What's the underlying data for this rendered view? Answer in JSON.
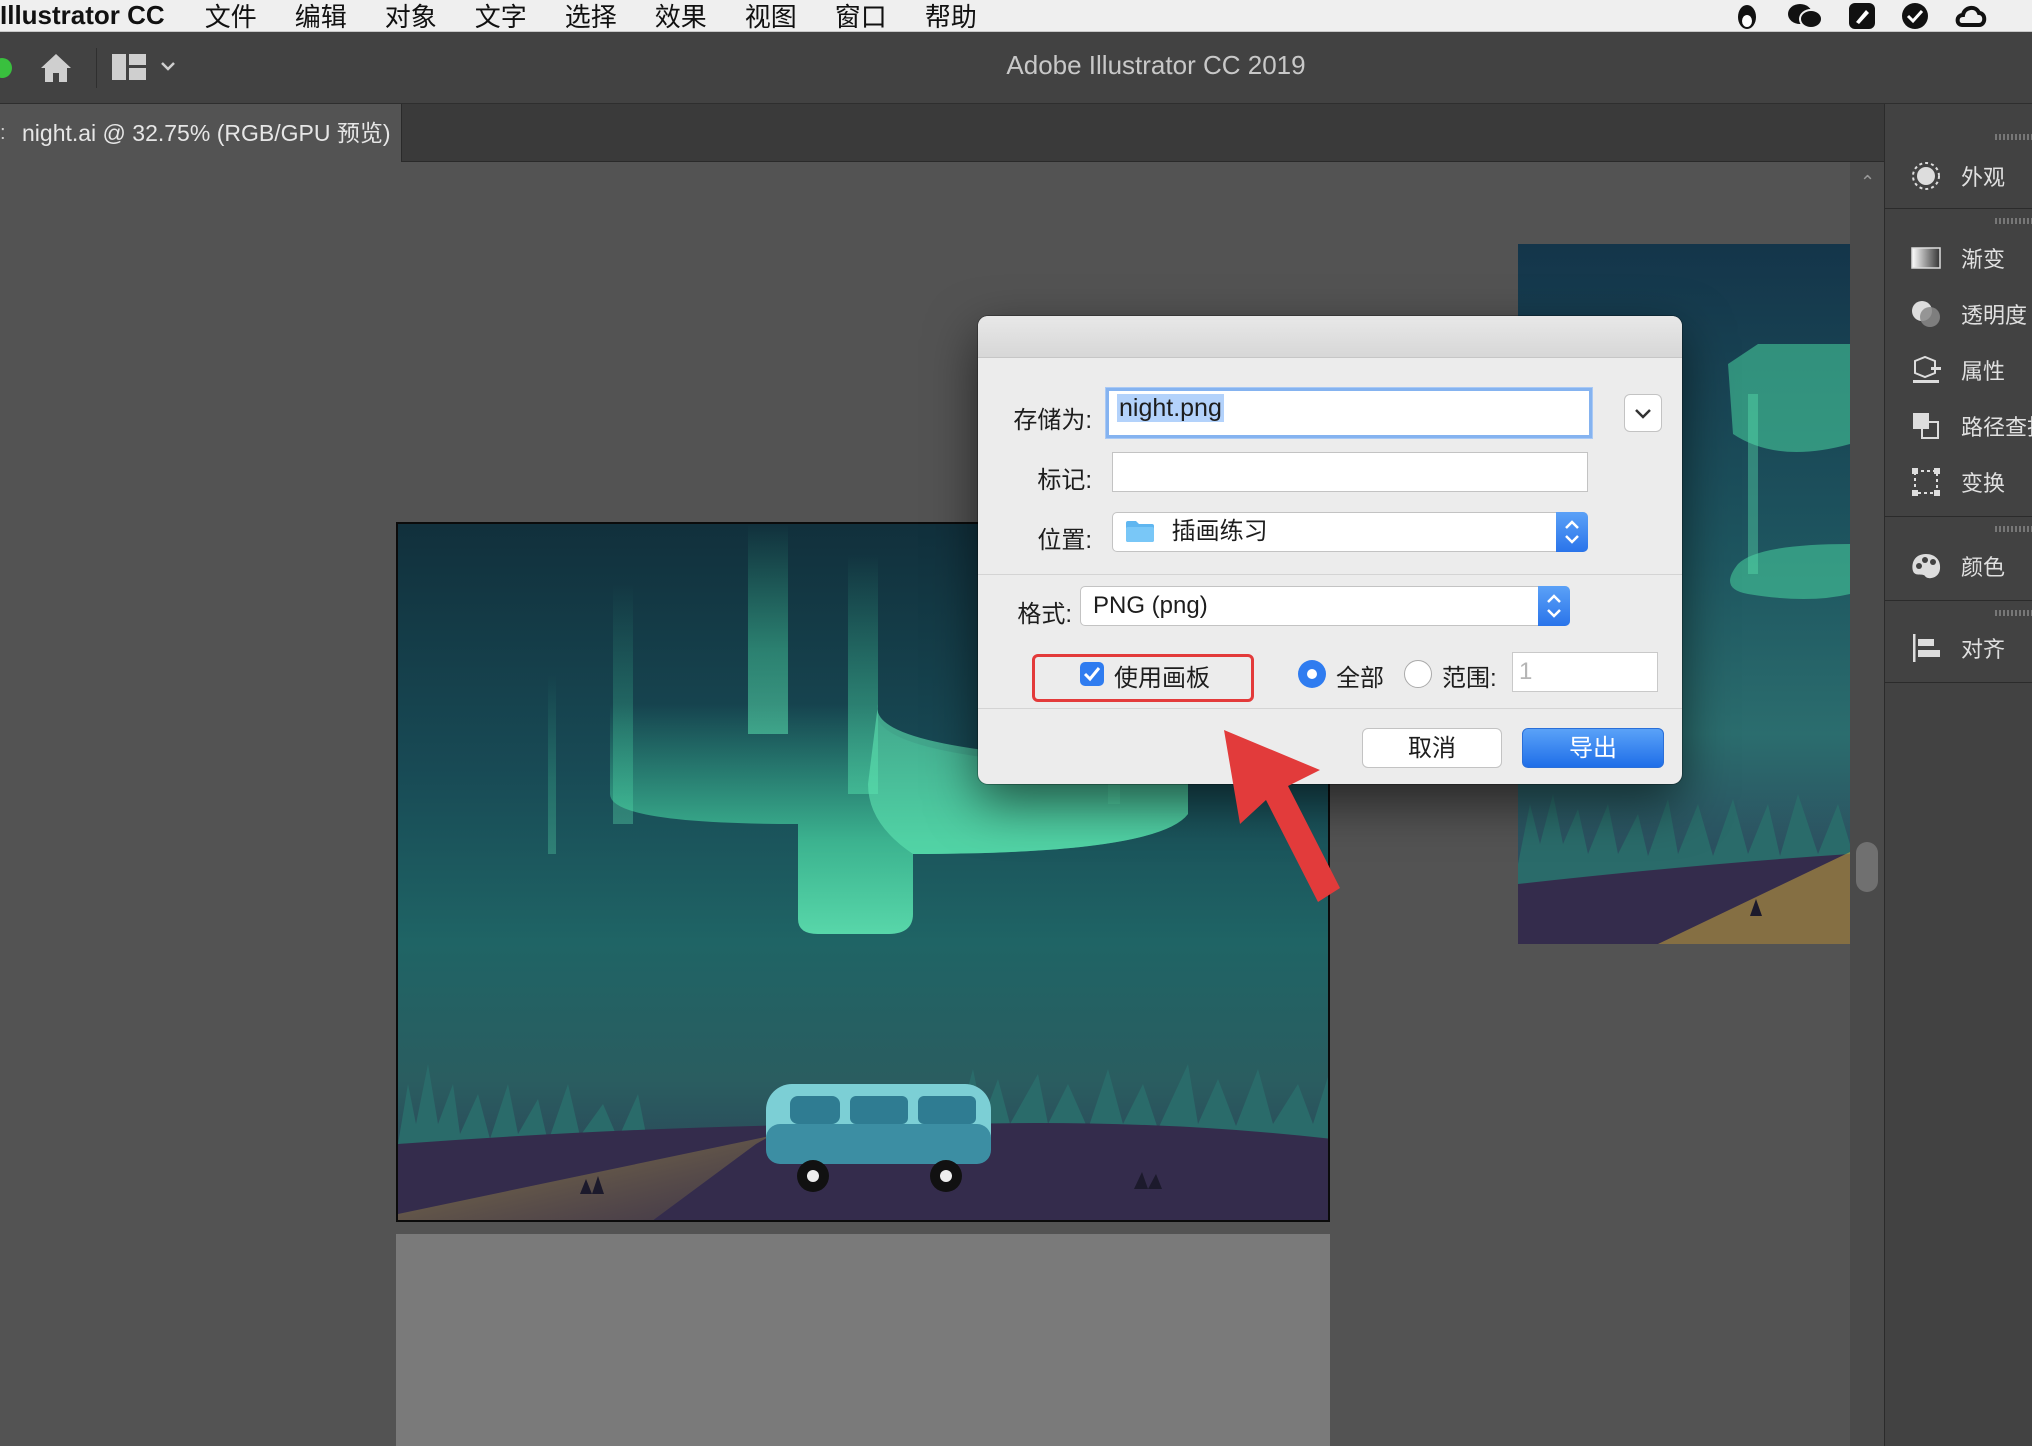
{
  "menubar": {
    "app_name": "Illustrator CC",
    "items": [
      "文件",
      "编辑",
      "对象",
      "文字",
      "选择",
      "效果",
      "视图",
      "窗口",
      "帮助"
    ]
  },
  "appbar": {
    "title": "Adobe Illustrator CC 2019"
  },
  "document_tab": {
    "title": "night.ai @ 32.75% (RGB/GPU 预览)"
  },
  "panels": [
    {
      "label": "外观",
      "icon": "appearance-icon"
    },
    {
      "label": "渐变",
      "icon": "gradient-icon"
    },
    {
      "label": "透明度",
      "icon": "transparency-icon"
    },
    {
      "label": "属性",
      "icon": "attributes-icon"
    },
    {
      "label": "路径查找器",
      "icon": "pathfinder-icon"
    },
    {
      "label": "变换",
      "icon": "transform-icon"
    },
    {
      "label": "颜色",
      "icon": "color-icon"
    },
    {
      "label": "对齐",
      "icon": "align-icon"
    }
  ],
  "export_dialog": {
    "save_as_label": "存储为:",
    "save_as_value": "night.png",
    "tags_label": "标记:",
    "tags_value": "",
    "location_label": "位置:",
    "location_value": "插画练习",
    "format_label": "格式:",
    "format_value": "PNG (png)",
    "use_artboards_label": "使用画板",
    "use_artboards_checked": true,
    "all_label": "全部",
    "range_label": "范围:",
    "range_value": "1",
    "cancel_label": "取消",
    "export_label": "导出"
  },
  "colors": {
    "accent": "#2f7cf0",
    "highlight": "#e33a3a",
    "panel_bg": "#424242",
    "canvas_bg": "#535353"
  }
}
